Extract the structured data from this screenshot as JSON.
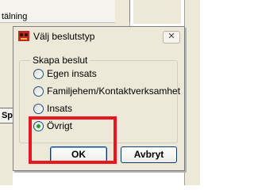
{
  "background": {
    "label_fragment": "tälning",
    "button_fragment": "Sp"
  },
  "dialog": {
    "title": "Välj beslutstyp",
    "close_glyph": "✕",
    "group_label": "Skapa beslut",
    "options": [
      {
        "label": "Egen insats",
        "checked": false
      },
      {
        "label": "Familjehem/Kontaktverksamhet",
        "checked": false
      },
      {
        "label": "Insats",
        "checked": false
      },
      {
        "label": "Övrigt",
        "checked": true
      }
    ],
    "ok_label": "OK",
    "cancel_label": "Avbryt"
  },
  "colors": {
    "highlight": "#e8161e",
    "dialog_bg": "#ece9d8",
    "radio_selected": "#21a121"
  }
}
